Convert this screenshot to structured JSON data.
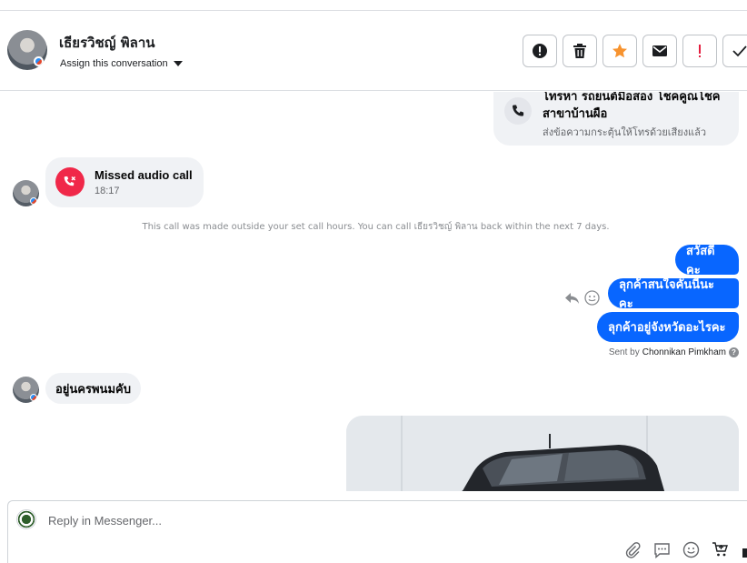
{
  "header": {
    "contact_name": "เธียรวิชญ์ พิลาน",
    "assign_label": "Assign this conversation",
    "actions": [
      {
        "icon": "spam-alert-icon"
      },
      {
        "icon": "trash-icon"
      },
      {
        "icon": "star-icon",
        "color": "#f7932f"
      },
      {
        "icon": "envelope-icon"
      },
      {
        "icon": "exclamation-icon",
        "color": "#e41e3f"
      },
      {
        "icon": "check-icon"
      }
    ]
  },
  "callout": {
    "title": "โทรหา รถยนต์มือสอง โชคคูณโชค สาขาบ้านผือ",
    "subtitle": "ส่งข้อความกระตุ้นให้โทรด้วยเสียงแล้ว"
  },
  "missed_call": {
    "title": "Missed audio call",
    "time": "18:17"
  },
  "notice": "This call was made outside your set call hours. You can call เธียรวิชญ์ พิลาน back within the next 7 days.",
  "outgoing_messages": [
    "สวัสดีคะ",
    "ลุกค้าสนใจคันนี้นะคะ",
    "ลุกค้าอยู่จังหวัดอะไรคะ"
  ],
  "sent_by": {
    "prefix": "Sent by",
    "name": "Chonnikan Pimkham"
  },
  "incoming_message": "อยู่นครพนมคับ",
  "composer": {
    "placeholder": "Reply in Messenger..."
  },
  "colors": {
    "accent": "#0866ff",
    "missed_call": "#f02849",
    "bubble_in": "#f0f2f5"
  }
}
